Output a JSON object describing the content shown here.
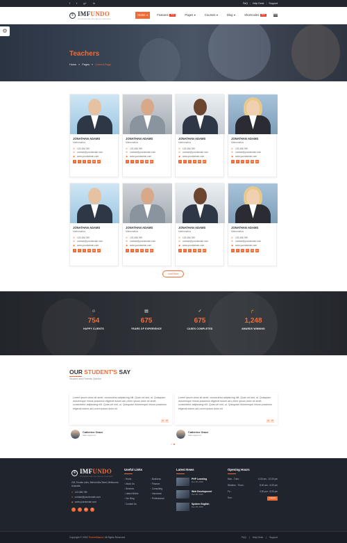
{
  "topbar": {
    "social": [
      "f",
      "t",
      "g+",
      "in"
    ],
    "links": [
      "FAQ",
      "Help Desk",
      "Support"
    ]
  },
  "header": {
    "logo_main": "IMF",
    "logo_accent": "UNDO",
    "logo_tagline": "PROFESSIONAL EDUCATION TEMPLATE",
    "nav": [
      {
        "label": "Home",
        "badge": "",
        "active": true
      },
      {
        "label": "Features",
        "badge": "New",
        "active": false
      },
      {
        "label": "Pages",
        "badge": "",
        "active": false
      },
      {
        "label": "Courses",
        "badge": "",
        "active": false
      },
      {
        "label": "Blog",
        "badge": "",
        "active": false
      },
      {
        "label": "Shortcodes",
        "badge": "New",
        "active": false
      }
    ]
  },
  "hero": {
    "title": "Teachers",
    "breadcrumb": [
      "Home",
      "Pages",
      "Current Page"
    ]
  },
  "teachers": [
    {
      "name": "JONATHAN ADAMS",
      "subject": "Mathematics",
      "phone": "123.456.789",
      "email": "contact@yourdomain.com",
      "web": "www.yourdomain.com",
      "style": "ph-a"
    },
    {
      "name": "JONATHAN ADAMS",
      "subject": "Mathematics",
      "phone": "123.456.789",
      "email": "contact@yourdomain.com",
      "web": "www.yourdomain.com",
      "style": "ph-b"
    },
    {
      "name": "JONATHAN ADAMS",
      "subject": "Mathematics",
      "phone": "123.456.789",
      "email": "contact@yourdomain.com",
      "web": "www.yourdomain.com",
      "style": "ph-c"
    },
    {
      "name": "JONATHAN ADAMS",
      "subject": "Mathematics",
      "phone": "123.456.789",
      "email": "contact@yourdomain.com",
      "web": "www.yourdomain.com",
      "style": "ph-d"
    },
    {
      "name": "JONATHAN ADAMS",
      "subject": "Mathematics",
      "phone": "123.456.789",
      "email": "contact@yourdomain.com",
      "web": "www.yourdomain.com",
      "style": "ph-a"
    },
    {
      "name": "JONATHAN ADAMS",
      "subject": "Mathematics",
      "phone": "123.456.789",
      "email": "contact@yourdomain.com",
      "web": "www.yourdomain.com",
      "style": "ph-b"
    },
    {
      "name": "JONATHAN ADAMS",
      "subject": "Mathematics",
      "phone": "123.456.789",
      "email": "contact@yourdomain.com",
      "web": "www.yourdomain.com",
      "style": "ph-c"
    },
    {
      "name": "JONATHAN ADAMS",
      "subject": "Mathematics",
      "phone": "123.456.789",
      "email": "contact@yourdomain.com",
      "web": "www.yourdomain.com",
      "style": "ph-d"
    }
  ],
  "teacher_social": [
    "f",
    "t",
    "v",
    "in",
    "◎",
    "g+"
  ],
  "load_more": "Load More",
  "stats": [
    {
      "icon": "☺",
      "value": "754",
      "label": "HAPPY CLIENTS"
    },
    {
      "icon": "▤",
      "value": "675",
      "label": "YEARS OF EXPERIENCE"
    },
    {
      "icon": "✓",
      "value": "675",
      "label": "CASES COMPLETED"
    },
    {
      "icon": "🎓",
      "value": "1,248",
      "label": "AWARDS WINNING"
    }
  ],
  "testimonials": {
    "title_a": "OUR ",
    "title_b": "STUDENT'S",
    "title_c": " SAY",
    "subtitle": "Student and Parents Opinion",
    "items": [
      {
        "text": "Lorem ipsum dolor sit amet, consectetur adipisicing elit. Quas vel sint, ut. Quisquam doloremque minus possimus eligendi dolore ad.Lorem ipsum dolor sit amet, consectetur adipisicing elit. Quas vel sint, ut. Quisquam doloremque minus possimus eligendi dolore ad.Lorem ipsum dolor sit",
        "name": "Catherine Grace",
        "role": "CEO apple.inc"
      },
      {
        "text": "Lorem ipsum dolor sit amet, consectetur adipisicing elit. Quas vel sint, ut. Quisquam doloremque minus possimus eligendi dolore ad.Lorem ipsum dolor sit amet, consectetur adipisicing elit. Quas vel sint, ut. Quisquam doloremque minus possimus eligendi dolore ad.Lorem ipsum dolor sit",
        "name": "Catherine Grace",
        "role": "CEO apple.inc"
      }
    ]
  },
  "footer": {
    "about": {
      "address": "203, Envato Labs, Behind Alis Steet, Melbourne, Australia.",
      "phone": "123.456.789",
      "email": "contact@yourdomain.com",
      "web": "www.yourdomain.com"
    },
    "useful_links_title": "Useful Links",
    "useful_links": [
      "Home",
      "Business",
      "About Us",
      "Finance",
      "Services",
      "Consulting",
      "Latest Works",
      "Insurance",
      "Our Blog",
      "Professional",
      "Contact Us"
    ],
    "news_title": "Latest News",
    "news": [
      {
        "title": "PHP Learning",
        "date": "Dec 08, 2015"
      },
      {
        "title": "Web Development",
        "date": "Dec 08, 2015"
      },
      {
        "title": "Spoken English",
        "date": "Dec 08, 2015"
      }
    ],
    "hours_title": "Opening Hours",
    "hours": [
      {
        "day": "Mon - Tues :",
        "time": "6.00 am - 10.00 pm"
      },
      {
        "day": "Wednes - Thurs :",
        "time": "8.00 am - 6.00 pm"
      },
      {
        "day": "Fri :",
        "time": "3.00 pm - 8.00 pm"
      },
      {
        "day": "Sun :",
        "time": "Closed"
      }
    ],
    "copyright_a": "Copyright © 2018 ",
    "copyright_b": "ThemeMascot",
    "copyright_c": ". All Rights Reserved",
    "bottom_links": [
      "FAQ",
      "Help Desk",
      "Support"
    ]
  },
  "colors": {
    "accent": "#f26b36",
    "dark": "#20242d"
  }
}
